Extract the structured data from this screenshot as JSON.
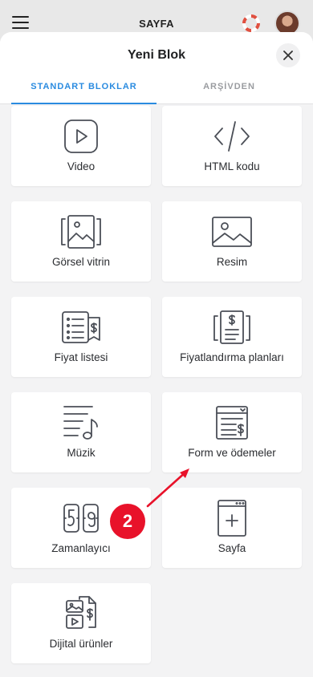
{
  "topbar": {
    "title": "SAYFA"
  },
  "sheet": {
    "title": "Yeni Blok",
    "tabs": [
      "STANDART BLOKLAR",
      "ARŞİVDEN"
    ]
  },
  "blocks": [
    {
      "label": "Video",
      "icon": "video-icon"
    },
    {
      "label": "HTML kodu",
      "icon": "code-icon"
    },
    {
      "label": "Görsel vitrin",
      "icon": "gallery-icon"
    },
    {
      "label": "Resim",
      "icon": "image-icon"
    },
    {
      "label": "Fiyat listesi",
      "icon": "price-list-icon"
    },
    {
      "label": "Fiyatlandırma planları",
      "icon": "pricing-plans-icon"
    },
    {
      "label": "Müzik",
      "icon": "music-icon"
    },
    {
      "label": "Form ve ödemeler",
      "icon": "form-payments-icon"
    },
    {
      "label": "Zamanlayıcı",
      "icon": "timer-icon"
    },
    {
      "label": "Sayfa",
      "icon": "add-page-icon"
    },
    {
      "label": "Dijital ürünler",
      "icon": "digital-products-icon"
    }
  ],
  "annotation": {
    "step": "2",
    "color": "#e8122a"
  },
  "colors": {
    "accent": "#2a8be0",
    "icon": "#4b4f57"
  }
}
